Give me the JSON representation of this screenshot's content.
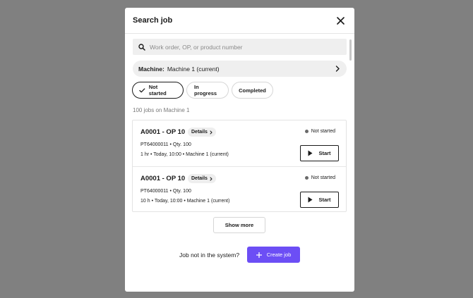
{
  "modal": {
    "title": "Search job",
    "close_icon": "close-icon"
  },
  "search": {
    "placeholder": "Work order, OP, or product number",
    "value": "",
    "icon": "search-icon"
  },
  "machine": {
    "label": "Machine:",
    "value": "Machine 1 (current)",
    "icon": "chevron-right-icon"
  },
  "filters": [
    {
      "label": "Not started",
      "active": true,
      "icon": "check-icon"
    },
    {
      "label": "In progress",
      "active": false
    },
    {
      "label": "Completed",
      "active": false
    }
  ],
  "count_text": "100 jobs on Machine 1",
  "jobs": [
    {
      "title": "A0001 - OP 10",
      "details_label": "Details",
      "meta1": "PT64000011 • Qty. 100",
      "meta2": "1 hr • Today, 10:00 • Machine 1 (current)",
      "status": "Not started",
      "start_label": "Start"
    },
    {
      "title": "A0001 - OP 10",
      "details_label": "Details",
      "meta1": "PT64000011 • Qty. 100",
      "meta2": "10 h • Today, 10:00 • Machine 1 (current)",
      "status": "Not started",
      "start_label": "Start"
    }
  ],
  "show_more_label": "Show more",
  "footer": {
    "prompt": "Job not in the system?",
    "create_label": "Create job"
  },
  "colors": {
    "backdrop": "#808080",
    "accent": "#6c4ef5",
    "status_dot": "#6a6a6a"
  }
}
